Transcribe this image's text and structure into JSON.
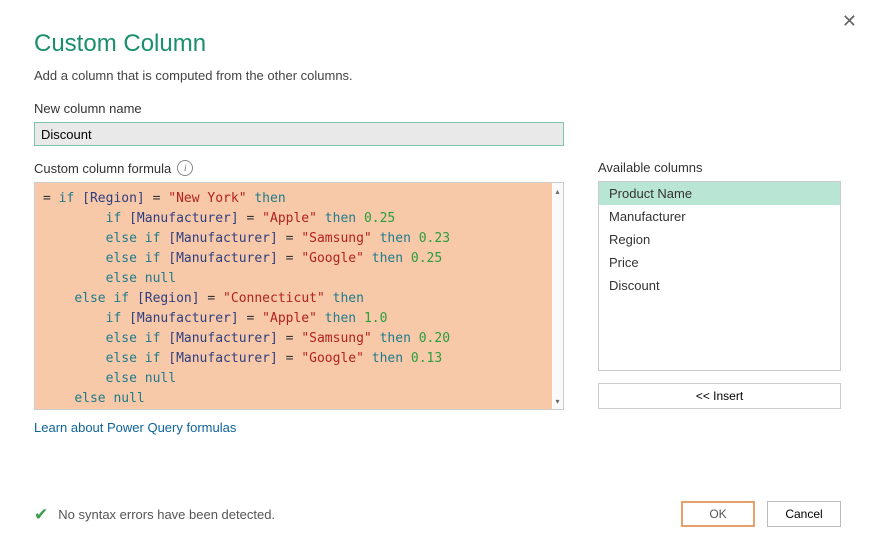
{
  "title": "Custom Column",
  "subtitle": "Add a column that is computed from the other columns.",
  "labels": {
    "new_column_name": "New column name",
    "custom_formula": "Custom column formula",
    "available_columns": "Available columns",
    "insert": "<< Insert",
    "learn_link": "Learn about Power Query formulas"
  },
  "new_column_value": "Discount",
  "formula": {
    "tokens": [
      [
        "txt",
        "= "
      ],
      [
        "kw",
        "if"
      ],
      [
        "txt",
        " "
      ],
      [
        "fld",
        "[Region]"
      ],
      [
        "txt",
        " = "
      ],
      [
        "str",
        "\"New York\""
      ],
      [
        "txt",
        " "
      ],
      [
        "kw",
        "then"
      ],
      [
        "nl"
      ],
      [
        "pad",
        8
      ],
      [
        "kw",
        "if"
      ],
      [
        "txt",
        " "
      ],
      [
        "fld",
        "[Manufacturer]"
      ],
      [
        "txt",
        " = "
      ],
      [
        "str",
        "\"Apple\""
      ],
      [
        "txt",
        " "
      ],
      [
        "kw",
        "then"
      ],
      [
        "txt",
        " "
      ],
      [
        "num",
        "0.25"
      ],
      [
        "nl"
      ],
      [
        "pad",
        8
      ],
      [
        "kw",
        "else if"
      ],
      [
        "txt",
        " "
      ],
      [
        "fld",
        "[Manufacturer]"
      ],
      [
        "txt",
        " = "
      ],
      [
        "str",
        "\"Samsung\""
      ],
      [
        "txt",
        " "
      ],
      [
        "kw",
        "then"
      ],
      [
        "txt",
        " "
      ],
      [
        "num",
        "0.23"
      ],
      [
        "nl"
      ],
      [
        "pad",
        8
      ],
      [
        "kw",
        "else if"
      ],
      [
        "txt",
        " "
      ],
      [
        "fld",
        "[Manufacturer]"
      ],
      [
        "txt",
        " = "
      ],
      [
        "str",
        "\"Google\""
      ],
      [
        "txt",
        " "
      ],
      [
        "kw",
        "then"
      ],
      [
        "txt",
        " "
      ],
      [
        "num",
        "0.25"
      ],
      [
        "nl"
      ],
      [
        "pad",
        8
      ],
      [
        "kw",
        "else"
      ],
      [
        "txt",
        " "
      ],
      [
        "nul",
        "null"
      ],
      [
        "nl"
      ],
      [
        "pad",
        4
      ],
      [
        "kw",
        "else if"
      ],
      [
        "txt",
        " "
      ],
      [
        "fld",
        "[Region]"
      ],
      [
        "txt",
        " = "
      ],
      [
        "str",
        "\"Connecticut\""
      ],
      [
        "txt",
        " "
      ],
      [
        "kw",
        "then"
      ],
      [
        "nl"
      ],
      [
        "pad",
        8
      ],
      [
        "kw",
        "if"
      ],
      [
        "txt",
        " "
      ],
      [
        "fld",
        "[Manufacturer]"
      ],
      [
        "txt",
        " = "
      ],
      [
        "str",
        "\"Apple\""
      ],
      [
        "txt",
        " "
      ],
      [
        "kw",
        "then"
      ],
      [
        "txt",
        " "
      ],
      [
        "num",
        "1.0"
      ],
      [
        "nl"
      ],
      [
        "pad",
        8
      ],
      [
        "kw",
        "else if"
      ],
      [
        "txt",
        " "
      ],
      [
        "fld",
        "[Manufacturer]"
      ],
      [
        "txt",
        " = "
      ],
      [
        "str",
        "\"Samsung\""
      ],
      [
        "txt",
        " "
      ],
      [
        "kw",
        "then"
      ],
      [
        "txt",
        " "
      ],
      [
        "num",
        "0.20"
      ],
      [
        "nl"
      ],
      [
        "pad",
        8
      ],
      [
        "kw",
        "else if"
      ],
      [
        "txt",
        " "
      ],
      [
        "fld",
        "[Manufacturer]"
      ],
      [
        "txt",
        " = "
      ],
      [
        "str",
        "\"Google\""
      ],
      [
        "txt",
        " "
      ],
      [
        "kw",
        "then"
      ],
      [
        "txt",
        " "
      ],
      [
        "num",
        "0.13"
      ],
      [
        "nl"
      ],
      [
        "pad",
        8
      ],
      [
        "kw",
        "else"
      ],
      [
        "txt",
        " "
      ],
      [
        "nul",
        "null"
      ],
      [
        "nl"
      ],
      [
        "pad",
        4
      ],
      [
        "kw",
        "else"
      ],
      [
        "txt",
        " "
      ],
      [
        "nul",
        "null"
      ]
    ]
  },
  "available": [
    {
      "name": "Product Name",
      "selected": true
    },
    {
      "name": "Manufacturer",
      "selected": false
    },
    {
      "name": "Region",
      "selected": false
    },
    {
      "name": "Price",
      "selected": false
    },
    {
      "name": "Discount",
      "selected": false
    }
  ],
  "status_text": "No syntax errors have been detected.",
  "buttons": {
    "ok": "OK",
    "cancel": "Cancel"
  }
}
